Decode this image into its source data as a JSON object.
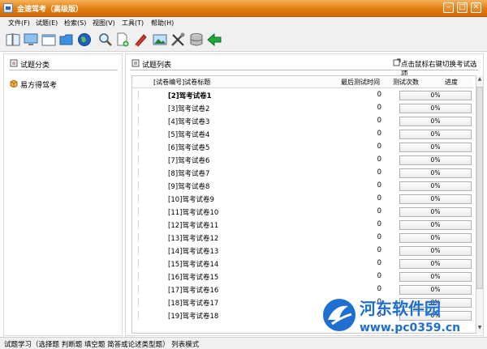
{
  "window": {
    "title": "金速驾考（高级版）"
  },
  "menu": [
    "文件(F)",
    "试题(E)",
    "检索(S)",
    "视图(V)",
    "工具(T)",
    "帮助(H)"
  ],
  "toolbar": [
    {
      "icon": "open-book-icon"
    },
    {
      "icon": "monitor-icon"
    },
    {
      "icon": "window-icon"
    },
    {
      "icon": "folder-icon"
    },
    {
      "icon": "globe-icon"
    },
    {
      "icon": "magnifier-icon"
    },
    {
      "icon": "new-document-icon"
    },
    {
      "icon": "pen-icon"
    },
    {
      "icon": "picture-icon"
    },
    {
      "icon": "tools-icon"
    },
    {
      "icon": "database-icon"
    },
    {
      "icon": "back-arrow-icon"
    }
  ],
  "left_panel": {
    "title": "试题分类",
    "item": "易方得驾考"
  },
  "right_panel": {
    "title": "试题列表",
    "hint": "点击鼠标右键切换考试选项",
    "columns": {
      "title": "[试卷编号]试卷标题",
      "last": "最后测试时间",
      "count": "测试次数",
      "progress": "进度"
    },
    "rows": [
      {
        "title": "[2]驾考试卷1",
        "count": "0",
        "progress": "0%"
      },
      {
        "title": "[3]驾考试卷2",
        "count": "0",
        "progress": "0%"
      },
      {
        "title": "[4]驾考试卷3",
        "count": "0",
        "progress": "0%"
      },
      {
        "title": "[5]驾考试卷4",
        "count": "0",
        "progress": "0%"
      },
      {
        "title": "[6]驾考试卷5",
        "count": "0",
        "progress": "0%"
      },
      {
        "title": "[7]驾考试卷6",
        "count": "0",
        "progress": "0%"
      },
      {
        "title": "[8]驾考试卷7",
        "count": "0",
        "progress": "0%"
      },
      {
        "title": "[9]驾考试卷8",
        "count": "0",
        "progress": "0%"
      },
      {
        "title": "[10]驾考试卷9",
        "count": "0",
        "progress": "0%"
      },
      {
        "title": "[11]驾考试卷10",
        "count": "0",
        "progress": "0%"
      },
      {
        "title": "[12]驾考试卷11",
        "count": "0",
        "progress": "0%"
      },
      {
        "title": "[13]驾考试卷12",
        "count": "0",
        "progress": "0%"
      },
      {
        "title": "[14]驾考试卷13",
        "count": "0",
        "progress": "0%"
      },
      {
        "title": "[15]驾考试卷14",
        "count": "0",
        "progress": "0%"
      },
      {
        "title": "[16]驾考试卷15",
        "count": "0",
        "progress": "0%"
      },
      {
        "title": "[17]驾考试卷16",
        "count": "0",
        "progress": "0%"
      },
      {
        "title": "[18]驾考试卷17",
        "count": "0",
        "progress": "0%"
      },
      {
        "title": "[19]驾考试卷18",
        "count": "0",
        "progress": "0%"
      }
    ]
  },
  "status": "试题学习（选择题  判断题  填空题  简答或论述类型题）      列表模式",
  "watermark": {
    "name": "河东软件园",
    "url": "www.pc0359.cn"
  },
  "colors": {
    "titlebar": "#e07c10",
    "watermark": "#1f6fd1",
    "toolbar_arrow": "#1fa83b"
  }
}
